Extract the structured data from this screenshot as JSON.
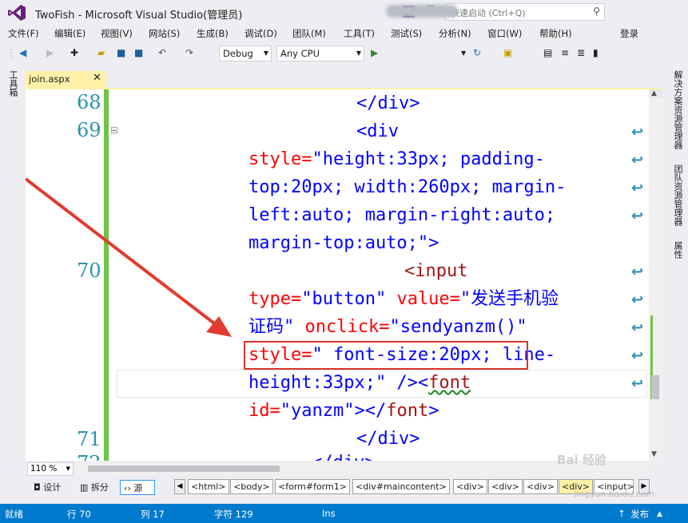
{
  "window": {
    "title": "TwoFish - Microsoft Visual Studio(管理员)",
    "notification_count": "3"
  },
  "quick_launch": {
    "placeholder": "快速启动 (Ctrl+Q)"
  },
  "menu": [
    "文件(F)",
    "编辑(E)",
    "视图(V)",
    "网站(S)",
    "生成(B)",
    "调试(D)",
    "团队(M)",
    "工具(T)",
    "测试(S)",
    "分析(N)",
    "窗口(W)",
    "帮助(H)"
  ],
  "signin": "登录",
  "toolbar": {
    "config": "Debug",
    "platform": "Any CPU"
  },
  "left_tabs": {
    "toolbox": "工具箱"
  },
  "right_tabs": [
    "解决方案资源管理器",
    "团队资源管理器",
    "属性"
  ],
  "document_tab": {
    "label": "join.aspx",
    "close": "✕"
  },
  "editor": {
    "line_numbers": [
      "68",
      "69",
      "70",
      "71",
      "72"
    ],
    "code": {
      "l68": "</div>",
      "l69a": "<div",
      "l69b_attr": "style=",
      "l69b_val": "\"height:33px; padding-",
      "l69c": "top:20px; width:260px; margin-",
      "l69d": "left:auto; margin-right:auto;",
      "l69e": "margin-top:auto;\"",
      "l69e_close": ">",
      "l70a": "<input",
      "l70b_attr": "type=",
      "l70b_val": "\"button\"",
      "l70b_attr2": " value=",
      "l70b_val2": "\"发送手机验",
      "l70c_val": "证码\"",
      "l70c_attr": " onclick=",
      "l70c_val2": "\"sendyanzm()\"",
      "l70d_attr": "style=",
      "l70d_val": "\" font-size:20px; line-",
      "l70e_val": "height:33px;\"",
      "l70e_close": " /><",
      "l70e_tag": "font",
      "l70f_attr": "id=",
      "l70f_val": "\"yanzm\"",
      "l70f_close": "></",
      "l70f_tag": "font",
      "l70f_end": ">",
      "l71": "</div>",
      "l72": "</div>"
    }
  },
  "zoom": "110 %",
  "views": {
    "design": "设计",
    "split": "拆分",
    "source": "源"
  },
  "breadcrumb": [
    "<html>",
    "<body>",
    "<form#form1>",
    "<div#maincontent>",
    "<div>",
    "<div>",
    "<div>",
    "<div>",
    "<input>"
  ],
  "status": {
    "ready": "就绪",
    "line": "行 70",
    "col": "列 17",
    "char": "字符 129",
    "mode": "Ins",
    "publish": "发布"
  },
  "watermark": {
    "logo": "Bai 经验",
    "url": "jingyan.baidu.com"
  }
}
